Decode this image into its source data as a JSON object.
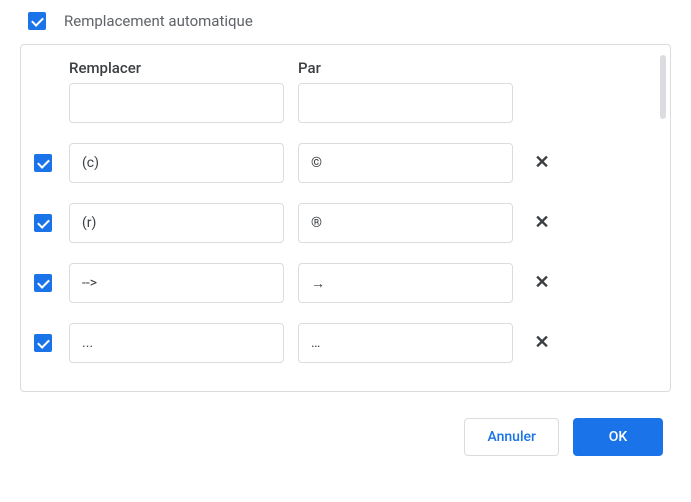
{
  "autoReplace": {
    "label": "Remplacement automatique",
    "checked": true
  },
  "headers": {
    "replace": "Remplacer",
    "with": "Par"
  },
  "rows": [
    {
      "checked": null,
      "replace": "",
      "with": "",
      "removable": false
    },
    {
      "checked": true,
      "replace": "(c)",
      "with": "©",
      "removable": true
    },
    {
      "checked": true,
      "replace": "(r)",
      "with": "®",
      "removable": true
    },
    {
      "checked": true,
      "replace": "-->",
      "with": "→",
      "removable": true
    },
    {
      "checked": true,
      "replace": "...",
      "with": "…",
      "removable": true
    }
  ],
  "buttons": {
    "cancel": "Annuler",
    "ok": "OK"
  },
  "icons": {
    "remove": "✕"
  }
}
